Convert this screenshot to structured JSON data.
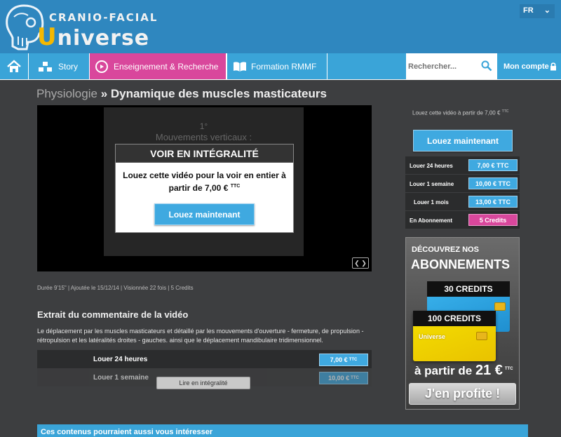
{
  "logo": {
    "top": "CRANIO-FACIAL",
    "bottom_first": "U",
    "bottom_rest": "niverse"
  },
  "lang": {
    "current": "FR"
  },
  "nav": {
    "story": "Story",
    "enseignement": "Enseignement & Recherche",
    "formation": "Formation RMMF",
    "search_placeholder": "Rechercher...",
    "account": "Mon compte"
  },
  "breadcrumb": {
    "parent": "Physiologie",
    "sep": "»",
    "title": "Dynamique des muscles masticateurs"
  },
  "video": {
    "slide_num": "1°",
    "slide_sub": "Mouvements verticaux :",
    "overlay_title": "VOIR EN INTÉGRALITÉ",
    "overlay_text_1": "Louez cette vidéo pour la voir en entier à",
    "overlay_text_2": "partir de 7,00 €",
    "overlay_ttc": "TTC",
    "overlay_button": "Louez maintenant"
  },
  "meta": "Durée 9'15\" | Ajoutée le 15/12/14 | Visionnée 22 fois | 5 Credits",
  "comment": {
    "title": "Extrait du commentaire de la vidéo",
    "text": "Le déplacement par les muscles masticateurs et détaillé par les mouvements d'ouverture - fermeture, de propulsion - rétropulsion et les latéralités droites - gauches. ainsi que le déplacement mandibulaire tridimensionnel."
  },
  "rent_table": {
    "row1_label": "Louer 24 heures",
    "row1_price": "7,00 €",
    "row2_label": "Louer 1 semaine",
    "row2_price": "10,00 €",
    "ttc": "TTC",
    "read_more": "Lire en intégralité"
  },
  "related": "Ces contenus pourraient aussi vous intéresser",
  "side": {
    "caption": "Louez cette vidéo à partir de 7,00 €",
    "caption_ttc": "TTC",
    "button": "Louez maintenant",
    "rows": [
      {
        "label": "Louer 24 heures",
        "value": "7,00 € TTC"
      },
      {
        "label": "Louer 1 semaine",
        "value": "10,00 € TTC"
      },
      {
        "label": "Louer 1 mois",
        "value": "13,00 € TTC"
      },
      {
        "label": "En Abonnement",
        "value": "5 Credits"
      }
    ]
  },
  "ad": {
    "t1": "DÉCOUVREZ NOS",
    "t2": "ABONNEMENTS",
    "card1": "30 CREDITS",
    "card2": "100 CREDITS",
    "card2_logo": "Universe",
    "price_pre": "à partir de",
    "price": "21 €",
    "price_ttc": "TTC",
    "cta": "J'en profite !"
  },
  "colors": {
    "header": "#2f87bf",
    "nav_blue": "#3aa4d8",
    "nav_pink": "#d9479c",
    "bg": "#3d3e40"
  }
}
